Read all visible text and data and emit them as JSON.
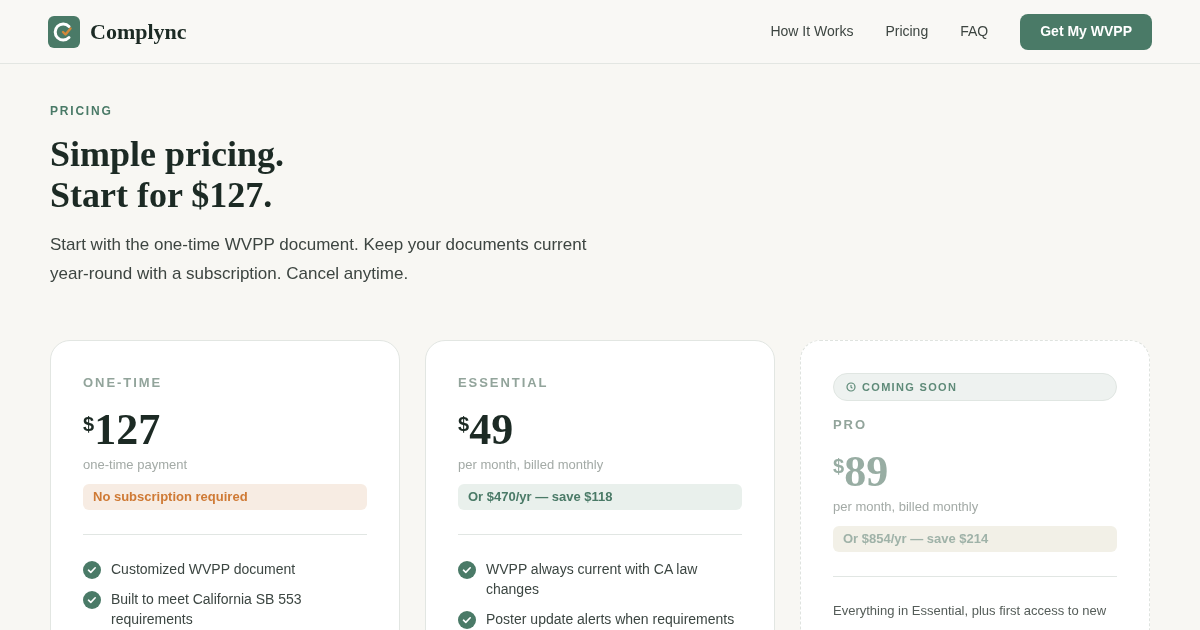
{
  "header": {
    "brand": "Complync",
    "nav": [
      "How It Works",
      "Pricing",
      "FAQ"
    ],
    "cta": "Get My WVPP"
  },
  "hero": {
    "eyebrow": "PRICING",
    "title_lines": [
      "Simple pricing.",
      "Start for $127."
    ],
    "lead": "Start with the one-time WVPP document. Keep your documents current year-round with a subscription. Cancel anytime."
  },
  "plans": [
    {
      "name": "ONE-TIME",
      "currency": "$",
      "price": "127",
      "period": "one-time payment",
      "note": {
        "text": "No subscription required",
        "kind": "warm"
      },
      "disabled": false,
      "features": [
        "Customized WVPP document",
        "Built to meet California SB 553 requirements"
      ]
    },
    {
      "name": "ESSENTIAL",
      "currency": "$",
      "price": "49",
      "period": "per month, billed monthly",
      "note": {
        "text": "Or $470/yr — save $118",
        "kind": "green"
      },
      "disabled": false,
      "features": [
        "WVPP always current with CA law changes",
        "Poster update alerts when requirements"
      ]
    },
    {
      "badge": "COMING SOON",
      "name": "PRO",
      "currency": "$",
      "price": "89",
      "period": "per month, billed monthly",
      "note": {
        "text": "Or $854/yr — save $214",
        "kind": "muted"
      },
      "disabled": true,
      "intro": "Everything in Essential, plus first access to new"
    }
  ]
}
